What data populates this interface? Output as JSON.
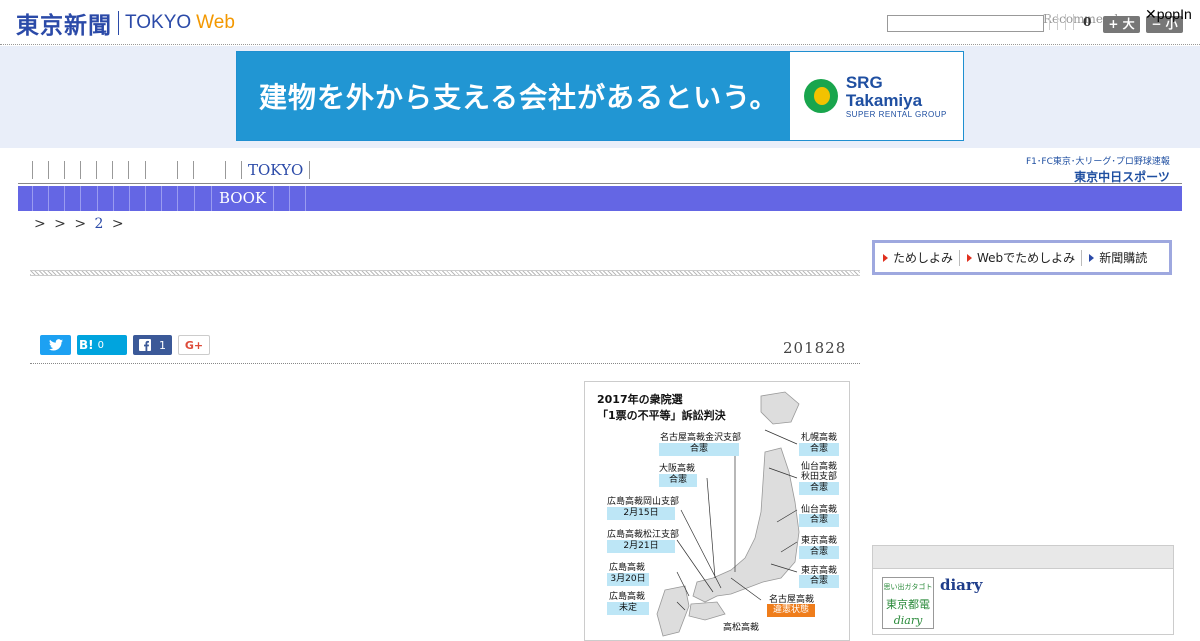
{
  "header": {
    "logo_jp": "東京新聞",
    "logo_en": "TOKYO",
    "logo_web": "Web",
    "search_placeholder": "",
    "recommend": "Recommend",
    "count": "0",
    "font_larger": "+ 大",
    "font_smaller": "− 小",
    "popin": "✕popIn"
  },
  "ad": {
    "headline": "建物を外から支える会社があるという。",
    "brand": "SRG Takamiya",
    "brand_sub": "SUPER RENTAL GROUP"
  },
  "nav": {
    "tokyo_label": "TOKYO",
    "book_label": "BOOK",
    "chunichi_line1": "F1･FC東京･大リーグ･プロ野球速報",
    "chunichi_line2": "東京中日スポーツ"
  },
  "breadcrumb": {
    "arrows": "> > >",
    "page": "2",
    "tail": ">"
  },
  "subscribe": {
    "item1": "ためしよみ",
    "item2": "Webでためしよみ",
    "item3": "新聞購読"
  },
  "share": {
    "hatena_label": "B!",
    "hatena_count": "0",
    "facebook_count": "1",
    "google_label": "G+"
  },
  "article": {
    "date": "201828"
  },
  "figure": {
    "title_line1": "2017年の衆院選",
    "title_line2": "「1票の不平等」訴訟判決",
    "courts": [
      {
        "name": "名古屋高裁金沢支部",
        "verdict": "合憲"
      },
      {
        "name": "大阪高裁",
        "verdict": "合憲"
      },
      {
        "name": "広島高裁岡山支部",
        "verdict": "2月15日"
      },
      {
        "name": "広島高裁松江支部",
        "verdict": "2月21日"
      },
      {
        "name": "広島高裁",
        "verdict": "3月20日"
      },
      {
        "name": "広島高裁",
        "verdict": "未定"
      },
      {
        "name": "札幌高裁",
        "verdict": "合憲"
      },
      {
        "name": "仙台高裁\n秋田支部",
        "verdict": "合憲"
      },
      {
        "name": "仙台高裁",
        "verdict": "合憲"
      },
      {
        "name": "東京高裁",
        "verdict": "合憲"
      },
      {
        "name": "東京高裁",
        "verdict": "合憲"
      },
      {
        "name": "名古屋高裁",
        "verdict": "違憲状態"
      },
      {
        "name": "高松高裁",
        "verdict": ""
      }
    ]
  },
  "sidebar": {
    "thumb_line1": "思い出ガタゴト",
    "thumb_line2": "東京都電",
    "thumb_line3": "diary",
    "title": "diary"
  }
}
